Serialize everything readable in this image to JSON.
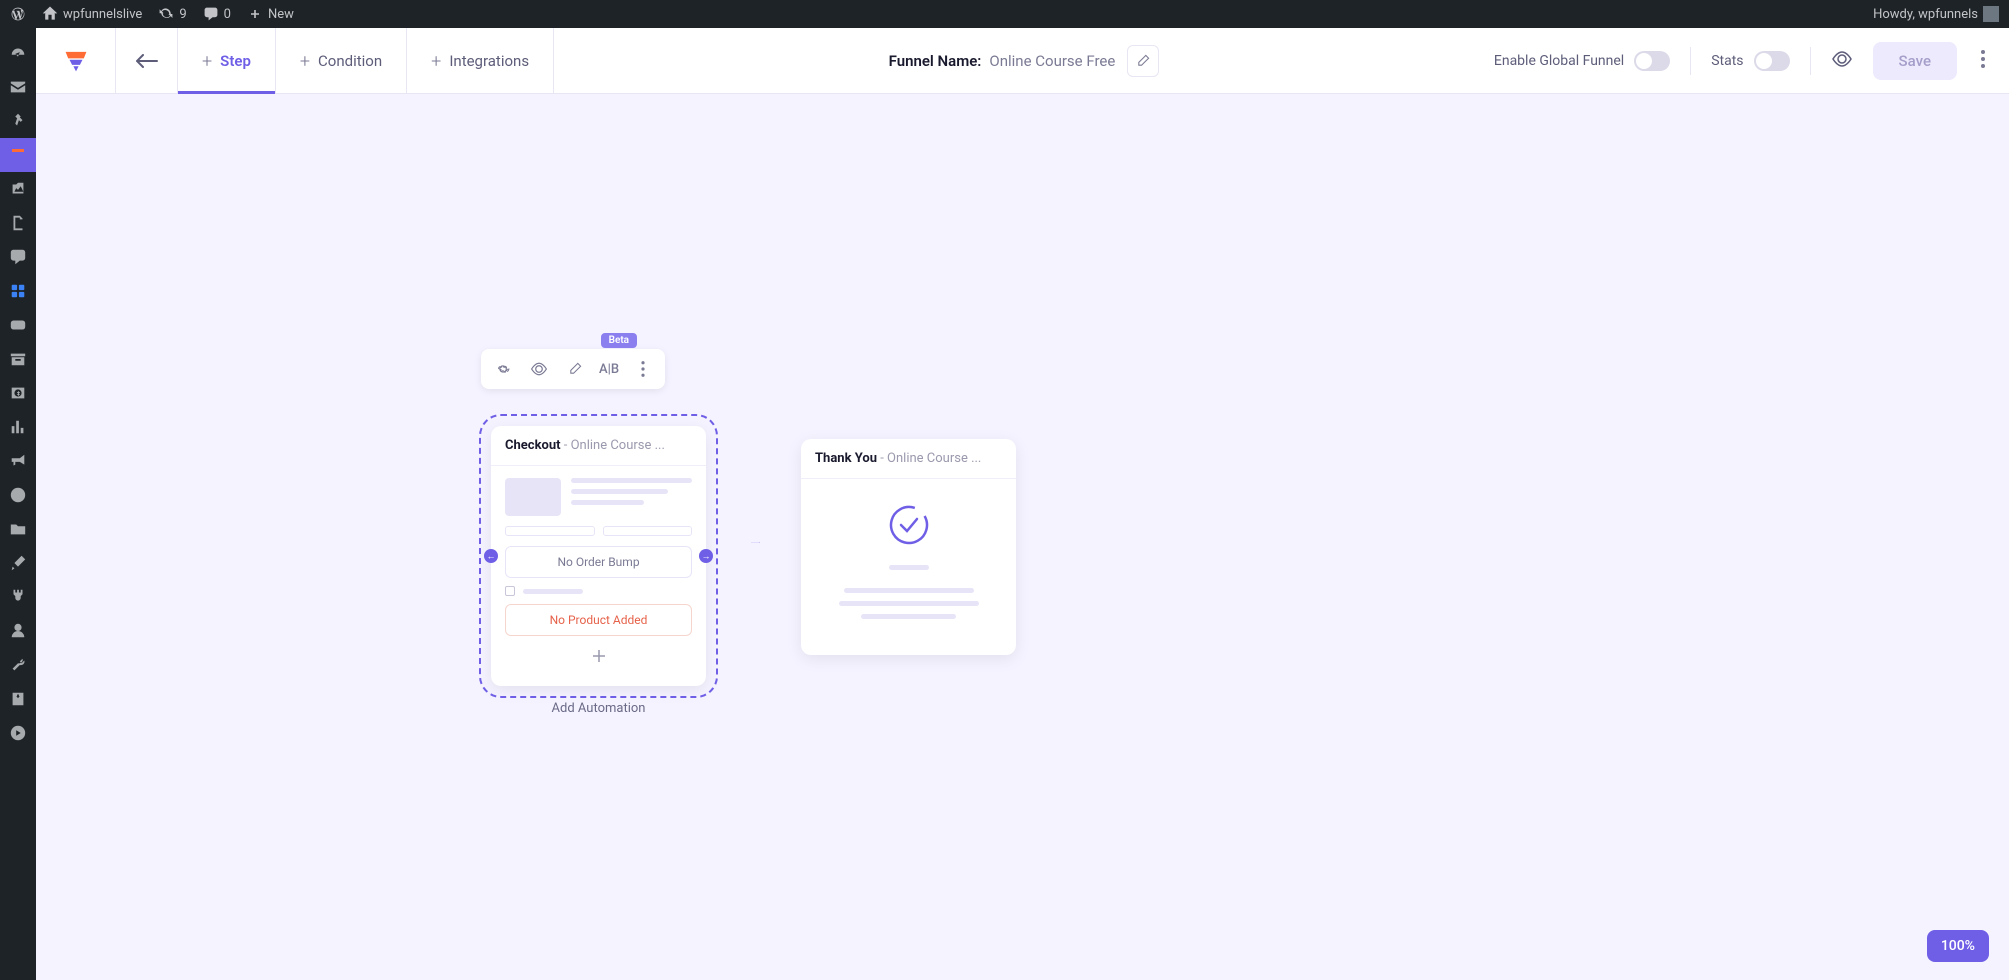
{
  "admin_bar": {
    "site_name": "wpfunnelslive",
    "updates": "9",
    "comments": "0",
    "new": "New",
    "greeting": "Howdy, wpfunnels"
  },
  "toolbar": {
    "tabs": {
      "step": "Step",
      "condition": "Condition",
      "integrations": "Integrations"
    },
    "funnel_name_label": "Funnel Name:",
    "funnel_name_value": "Online Course Free",
    "enable_global": "Enable Global Funnel",
    "stats": "Stats",
    "save": "Save"
  },
  "step_toolbar": {
    "ab": "A|B",
    "beta": "Beta"
  },
  "checkout_node": {
    "title": "Checkout",
    "subtitle": " - Online Course ...",
    "no_order_bump": "No Order Bump",
    "no_product": "No Product Added",
    "add_automation": "Add Automation"
  },
  "thankyou_node": {
    "title": "Thank You",
    "subtitle": " - Online Course ..."
  },
  "zoom": "100%"
}
